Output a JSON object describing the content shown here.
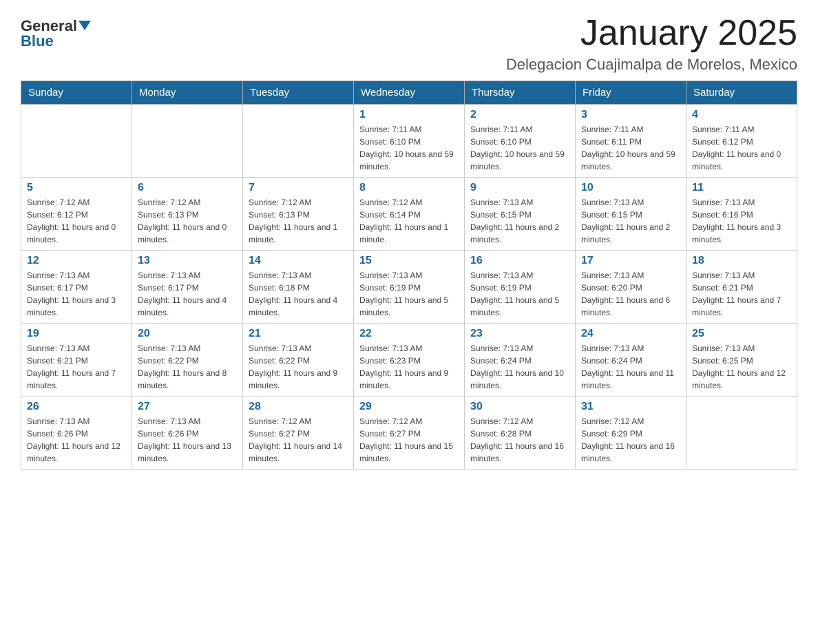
{
  "header": {
    "logo_general": "General",
    "logo_blue": "Blue",
    "month_title": "January 2025",
    "location": "Delegacion Cuajimalpa de Morelos, Mexico"
  },
  "days_of_week": [
    "Sunday",
    "Monday",
    "Tuesday",
    "Wednesday",
    "Thursday",
    "Friday",
    "Saturday"
  ],
  "weeks": [
    [
      {
        "day": "",
        "info": ""
      },
      {
        "day": "",
        "info": ""
      },
      {
        "day": "",
        "info": ""
      },
      {
        "day": "1",
        "info": "Sunrise: 7:11 AM\nSunset: 6:10 PM\nDaylight: 10 hours and 59 minutes."
      },
      {
        "day": "2",
        "info": "Sunrise: 7:11 AM\nSunset: 6:10 PM\nDaylight: 10 hours and 59 minutes."
      },
      {
        "day": "3",
        "info": "Sunrise: 7:11 AM\nSunset: 6:11 PM\nDaylight: 10 hours and 59 minutes."
      },
      {
        "day": "4",
        "info": "Sunrise: 7:11 AM\nSunset: 6:12 PM\nDaylight: 11 hours and 0 minutes."
      }
    ],
    [
      {
        "day": "5",
        "info": "Sunrise: 7:12 AM\nSunset: 6:12 PM\nDaylight: 11 hours and 0 minutes."
      },
      {
        "day": "6",
        "info": "Sunrise: 7:12 AM\nSunset: 6:13 PM\nDaylight: 11 hours and 0 minutes."
      },
      {
        "day": "7",
        "info": "Sunrise: 7:12 AM\nSunset: 6:13 PM\nDaylight: 11 hours and 1 minute."
      },
      {
        "day": "8",
        "info": "Sunrise: 7:12 AM\nSunset: 6:14 PM\nDaylight: 11 hours and 1 minute."
      },
      {
        "day": "9",
        "info": "Sunrise: 7:13 AM\nSunset: 6:15 PM\nDaylight: 11 hours and 2 minutes."
      },
      {
        "day": "10",
        "info": "Sunrise: 7:13 AM\nSunset: 6:15 PM\nDaylight: 11 hours and 2 minutes."
      },
      {
        "day": "11",
        "info": "Sunrise: 7:13 AM\nSunset: 6:16 PM\nDaylight: 11 hours and 3 minutes."
      }
    ],
    [
      {
        "day": "12",
        "info": "Sunrise: 7:13 AM\nSunset: 6:17 PM\nDaylight: 11 hours and 3 minutes."
      },
      {
        "day": "13",
        "info": "Sunrise: 7:13 AM\nSunset: 6:17 PM\nDaylight: 11 hours and 4 minutes."
      },
      {
        "day": "14",
        "info": "Sunrise: 7:13 AM\nSunset: 6:18 PM\nDaylight: 11 hours and 4 minutes."
      },
      {
        "day": "15",
        "info": "Sunrise: 7:13 AM\nSunset: 6:19 PM\nDaylight: 11 hours and 5 minutes."
      },
      {
        "day": "16",
        "info": "Sunrise: 7:13 AM\nSunset: 6:19 PM\nDaylight: 11 hours and 5 minutes."
      },
      {
        "day": "17",
        "info": "Sunrise: 7:13 AM\nSunset: 6:20 PM\nDaylight: 11 hours and 6 minutes."
      },
      {
        "day": "18",
        "info": "Sunrise: 7:13 AM\nSunset: 6:21 PM\nDaylight: 11 hours and 7 minutes."
      }
    ],
    [
      {
        "day": "19",
        "info": "Sunrise: 7:13 AM\nSunset: 6:21 PM\nDaylight: 11 hours and 7 minutes."
      },
      {
        "day": "20",
        "info": "Sunrise: 7:13 AM\nSunset: 6:22 PM\nDaylight: 11 hours and 8 minutes."
      },
      {
        "day": "21",
        "info": "Sunrise: 7:13 AM\nSunset: 6:22 PM\nDaylight: 11 hours and 9 minutes."
      },
      {
        "day": "22",
        "info": "Sunrise: 7:13 AM\nSunset: 6:23 PM\nDaylight: 11 hours and 9 minutes."
      },
      {
        "day": "23",
        "info": "Sunrise: 7:13 AM\nSunset: 6:24 PM\nDaylight: 11 hours and 10 minutes."
      },
      {
        "day": "24",
        "info": "Sunrise: 7:13 AM\nSunset: 6:24 PM\nDaylight: 11 hours and 11 minutes."
      },
      {
        "day": "25",
        "info": "Sunrise: 7:13 AM\nSunset: 6:25 PM\nDaylight: 11 hours and 12 minutes."
      }
    ],
    [
      {
        "day": "26",
        "info": "Sunrise: 7:13 AM\nSunset: 6:26 PM\nDaylight: 11 hours and 12 minutes."
      },
      {
        "day": "27",
        "info": "Sunrise: 7:13 AM\nSunset: 6:26 PM\nDaylight: 11 hours and 13 minutes."
      },
      {
        "day": "28",
        "info": "Sunrise: 7:12 AM\nSunset: 6:27 PM\nDaylight: 11 hours and 14 minutes."
      },
      {
        "day": "29",
        "info": "Sunrise: 7:12 AM\nSunset: 6:27 PM\nDaylight: 11 hours and 15 minutes."
      },
      {
        "day": "30",
        "info": "Sunrise: 7:12 AM\nSunset: 6:28 PM\nDaylight: 11 hours and 16 minutes."
      },
      {
        "day": "31",
        "info": "Sunrise: 7:12 AM\nSunset: 6:29 PM\nDaylight: 11 hours and 16 minutes."
      },
      {
        "day": "",
        "info": ""
      }
    ]
  ]
}
